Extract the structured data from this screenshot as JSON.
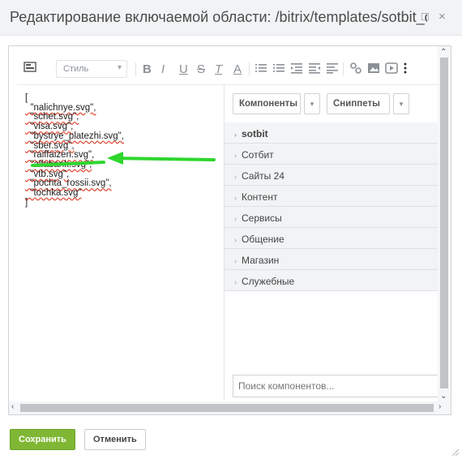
{
  "window": {
    "title": "Редактирование включаемой области: /bitrix/templates/sotbit_origami/include/sotbit_origami/footer/",
    "maximize_glyph": "□",
    "close_glyph": "×"
  },
  "toolbar": {
    "style_label": "Стиль",
    "bold": "B",
    "italic": "I",
    "underline": "U",
    "strike": "S",
    "clear": "T",
    "color": "A"
  },
  "code": {
    "lines": [
      "[",
      "  \"nalichnye.svg\",",
      "  \"schet.svg\",",
      "  \"visa.svg\",",
      "  \"bystrye_platezhi.svg\",",
      "  \"sber.svg\",",
      "  \"raiffaizen.svg\",",
      "  \"alfabank.svg\",",
      "  \"vtb.svg\",",
      "  \"pochta_rossii.svg\",",
      "  \"tochka.svg\"",
      "]"
    ]
  },
  "panel": {
    "components_label": "Компоненты",
    "snippets_label": "Сниппеты",
    "dropdown_glyph": "▾",
    "groups": [
      "sotbit",
      "Сотбит",
      "Сайты 24",
      "Контент",
      "Сервисы",
      "Общение",
      "Магазин",
      "Служебные"
    ],
    "search_placeholder": "Поиск компонентов..."
  },
  "footer": {
    "save_label": "Сохранить",
    "cancel_label": "Отменить"
  },
  "colors": {
    "save_button": "#7fb734",
    "annotation": "#2ed62e"
  }
}
